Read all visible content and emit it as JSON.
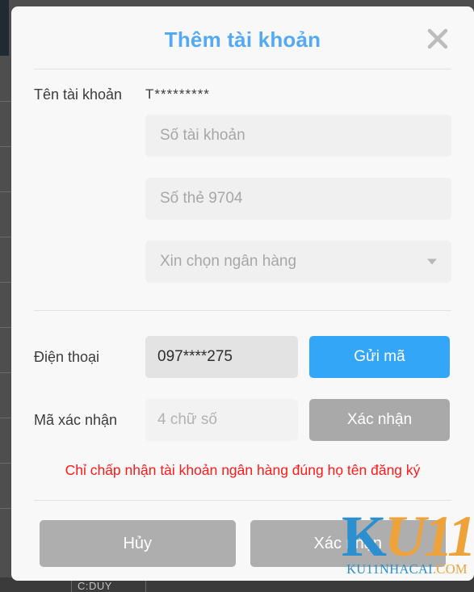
{
  "modal": {
    "title": "Thêm tài khoản",
    "close_icon": "close-icon"
  },
  "form": {
    "account_name": {
      "label": "Tên tài khoản",
      "value": "T*********"
    },
    "account_number": {
      "placeholder": "Số tài khoản",
      "value": ""
    },
    "card_number": {
      "placeholder": "Số thẻ 9704",
      "value": ""
    },
    "bank_select": {
      "selected": "Xin chọn ngân hàng",
      "caret_icon": "chevron-down-icon"
    },
    "phone": {
      "label": "Điện thoại",
      "value": "097****275",
      "send_code_label": "Gửi mã"
    },
    "verification_code": {
      "label": "Mã xác nhận",
      "placeholder": "4 chữ số",
      "value": "",
      "verify_label": "Xác nhận"
    },
    "warning": "Chỉ chấp nhận tài khoản ngân hàng đúng họ tên đăng ký"
  },
  "footer": {
    "cancel_label": "Hủy",
    "confirm_label": "Xác nhận"
  },
  "watermark": {
    "brand_k": "K",
    "brand_u": "U",
    "brand_one": "11",
    "domain_name": "KU11NHACAI",
    "domain_tld": ".COM"
  },
  "background": {
    "bottom_label": "C:DUY"
  },
  "colors": {
    "title_blue": "#54a9f5",
    "primary_button": "#34a6f7",
    "muted_button": "#a9a9a9",
    "footer_button": "#aeaeae",
    "warning_red": "#ff1a1a",
    "modal_bg": "#f8f8f8",
    "input_bg": "#f0f0f0",
    "phone_input_bg": "#e3e3e3"
  }
}
